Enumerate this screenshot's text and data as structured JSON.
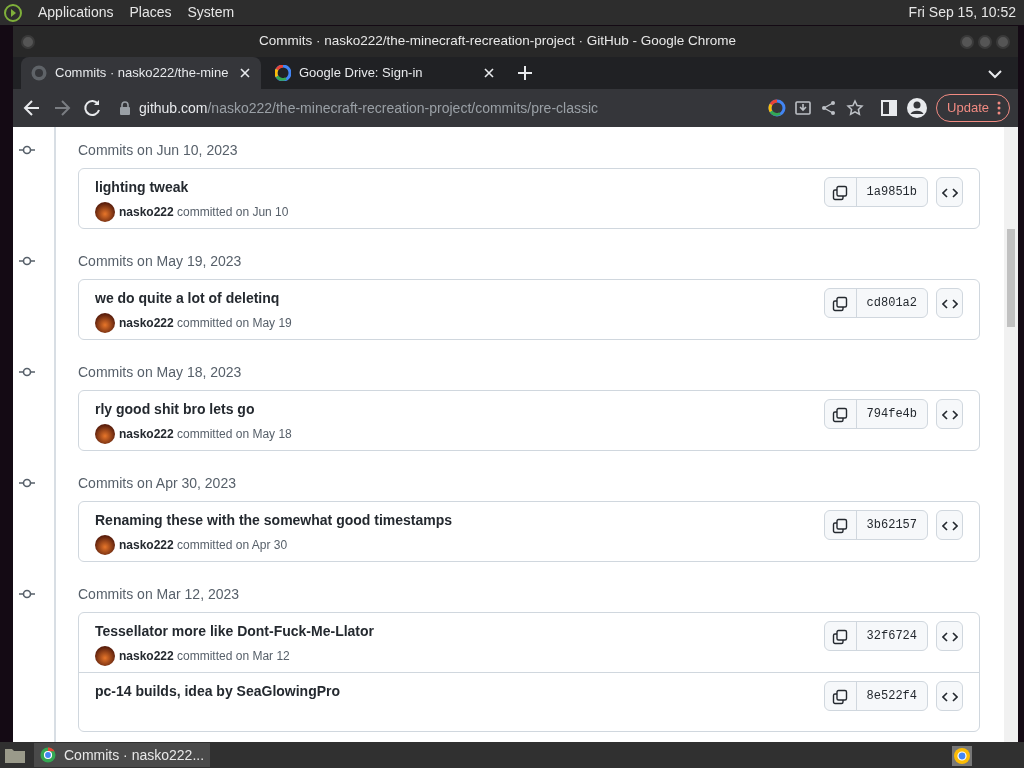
{
  "top_panel": {
    "menus": [
      "Applications",
      "Places",
      "System"
    ],
    "clock": "Fri Sep 15, 10:52"
  },
  "window": {
    "title": "Commits · nasko222/the-minecraft-recreation-project · GitHub - Google Chrome"
  },
  "tabs": [
    {
      "label": "Commits · nasko222/the-mine",
      "selected": true,
      "kind": "github"
    },
    {
      "label": "Google Drive: Sign-in",
      "selected": false,
      "kind": "google"
    }
  ],
  "address": {
    "host": "github.com",
    "path": "/nasko222/the-minecraft-recreation-project/commits/pre-classic"
  },
  "update_button": "Update",
  "groups": [
    {
      "date": "Commits on Jun 10, 2023",
      "commits": [
        {
          "title": "lighting tweak",
          "author": "nasko222",
          "meta": "committed on Jun 10",
          "sha": "1a9851b"
        }
      ]
    },
    {
      "date": "Commits on May 19, 2023",
      "commits": [
        {
          "title": "we do quite a lot of deletinq",
          "author": "nasko222",
          "meta": "committed on May 19",
          "sha": "cd801a2"
        }
      ]
    },
    {
      "date": "Commits on May 18, 2023",
      "commits": [
        {
          "title": "rly good shit bro lets go",
          "author": "nasko222",
          "meta": "committed on May 18",
          "sha": "794fe4b"
        }
      ]
    },
    {
      "date": "Commits on Apr 30, 2023",
      "commits": [
        {
          "title": "Renaming these with the somewhat good timestamps",
          "author": "nasko222",
          "meta": "committed on Apr 30",
          "sha": "3b62157"
        }
      ]
    },
    {
      "date": "Commits on Mar 12, 2023",
      "commits": [
        {
          "title": "Tessellator more like Dont-Fuck-Me-Llator",
          "author": "nasko222",
          "meta": "committed on Mar 12",
          "sha": "32f6724"
        },
        {
          "title": "pc-14 builds, idea by SeaGlowingPro",
          "sha": "8e522f4"
        }
      ]
    }
  ],
  "taskbar": {
    "items": [
      {
        "label": "Commits · nasko222...",
        "selected": true
      }
    ]
  }
}
